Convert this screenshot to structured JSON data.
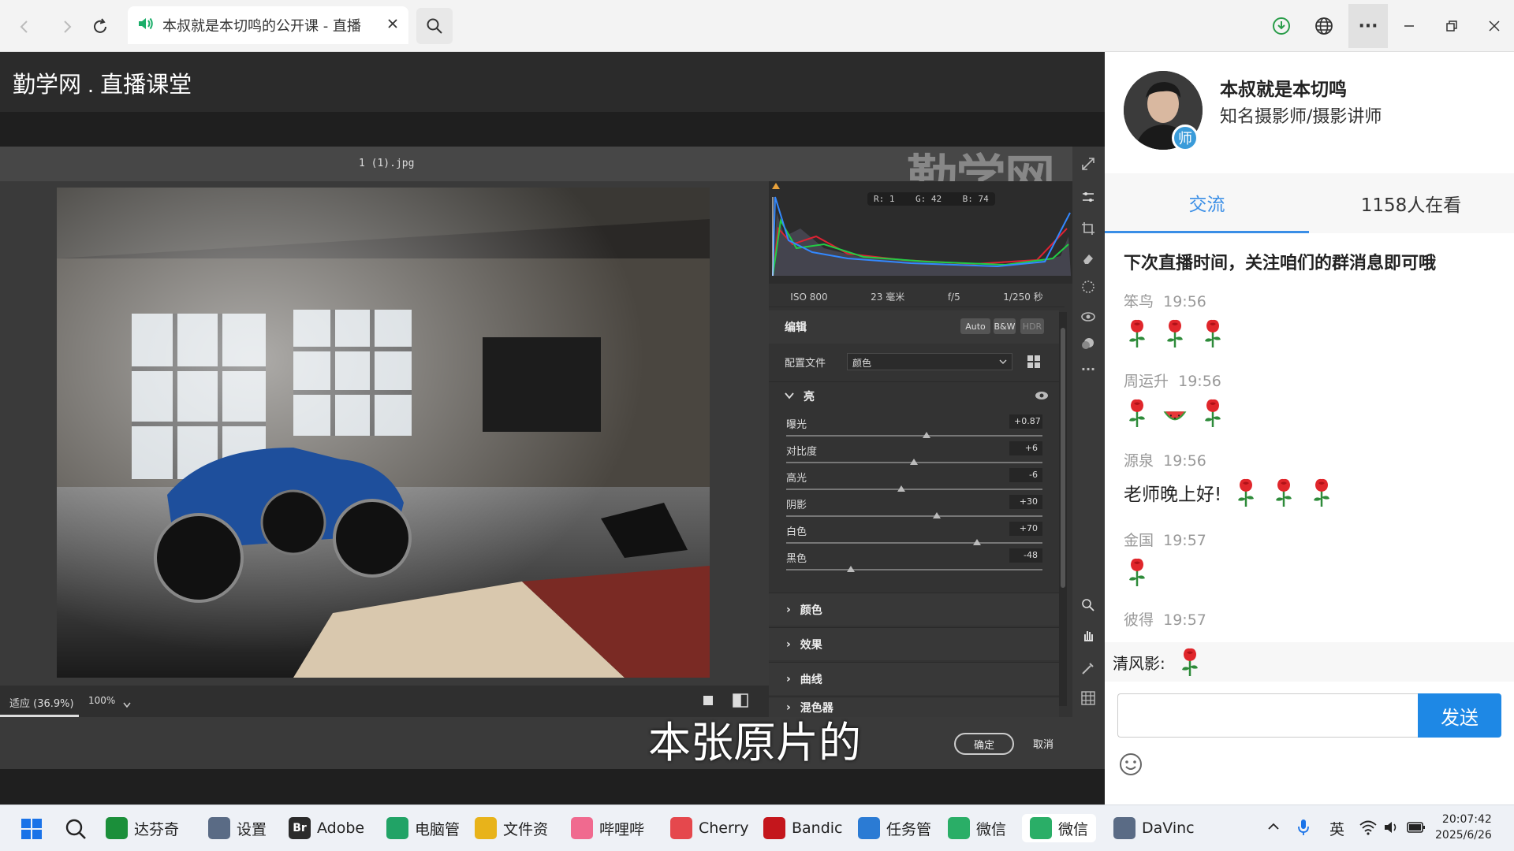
{
  "browser": {
    "tab_title": "本叔就是本切鸣的公开课 - 直播",
    "icons": [
      "back-icon",
      "forward-icon",
      "refresh-icon",
      "speaker-icon",
      "close-icon",
      "search-icon",
      "download-icon",
      "globe-icon",
      "more-icon",
      "minimize-icon",
      "restore-icon",
      "window-close-icon"
    ],
    "more_label": "···"
  },
  "live": {
    "title": "勤学网 . 直播课堂",
    "subtitle": "本张原片的",
    "watermark": "勤学网"
  },
  "ps": {
    "filename": "1 (1).jpg",
    "rgb": {
      "r": "R: 1",
      "g": "G: 42",
      "b": "B: 74"
    },
    "exif": [
      "ISO 800",
      "23 毫米",
      "f/5",
      "1/250 秒"
    ],
    "edit_label": "编辑",
    "pills": [
      "Auto",
      "B&W",
      "HDR"
    ],
    "profile_label": "配置文件",
    "profile_value": "颜色",
    "light_section": "亮",
    "sliders": [
      {
        "label": "曝光",
        "value": "+0.87",
        "pos": 0.54
      },
      {
        "label": "对比度",
        "value": "+6",
        "pos": 0.49
      },
      {
        "label": "高光",
        "value": "-6",
        "pos": 0.44
      },
      {
        "label": "阴影",
        "value": "+30",
        "pos": 0.58
      },
      {
        "label": "白色",
        "value": "+70",
        "pos": 0.74
      },
      {
        "label": "黑色",
        "value": "-48",
        "pos": 0.24
      }
    ],
    "sections": [
      "颜色",
      "效果",
      "曲线",
      "混色器"
    ],
    "zoom_fit": "适应 (36.9%)",
    "zoom_pct": "100%",
    "ok": "确定",
    "cancel": "取消"
  },
  "host": {
    "name": "本叔就是本切鸣",
    "title": "知名摄影师/摄影讲师",
    "badge": "师"
  },
  "tabs": {
    "chat": "交流",
    "viewers": "1158人在看"
  },
  "chat": {
    "notice": "下次直播时间，关注咱们的群消息即可哦",
    "messages": [
      {
        "user": "笨鸟",
        "time": "19:56",
        "text": "",
        "emojis": [
          "rose",
          "rose",
          "rose"
        ]
      },
      {
        "user": "周运升",
        "time": "19:56",
        "text": "",
        "emojis": [
          "rose",
          "watermelon",
          "rose"
        ]
      },
      {
        "user": "源泉",
        "time": "19:56",
        "text": "老师晚上好!",
        "emojis": [
          "rose",
          "rose",
          "rose"
        ]
      },
      {
        "user": "金国",
        "time": "19:57",
        "text": "",
        "emojis": [
          "rose"
        ]
      },
      {
        "user": "彼得",
        "time": "19:57",
        "text": "",
        "emojis": []
      }
    ],
    "pinned_user": "清风影:",
    "send_label": "发送"
  },
  "taskbar": {
    "items": [
      {
        "label": "达芬奇",
        "color": "#1b8f3a"
      },
      {
        "label": "设置",
        "color": "#5a6b85"
      },
      {
        "label": "Adobe",
        "color": "#2b2b2b"
      },
      {
        "label": "电脑管",
        "color": "#21a366"
      },
      {
        "label": "文件资",
        "color": "#e8b31a"
      },
      {
        "label": "哔哩哔",
        "color": "#f06a8f"
      },
      {
        "label": "Cherry",
        "color": "#e5484d"
      },
      {
        "label": "Bandic",
        "color": "#c4161c"
      },
      {
        "label": "任务管",
        "color": "#2b7bd4"
      },
      {
        "label": "微信",
        "color": "#2aae67"
      },
      {
        "label": "微信",
        "color": "#2aae67"
      },
      {
        "label": "DaVinc",
        "color": "#5a6b85"
      }
    ],
    "br_label": "Br",
    "ime": "英",
    "time": "20:07:42",
    "date": "2025/6/26"
  }
}
